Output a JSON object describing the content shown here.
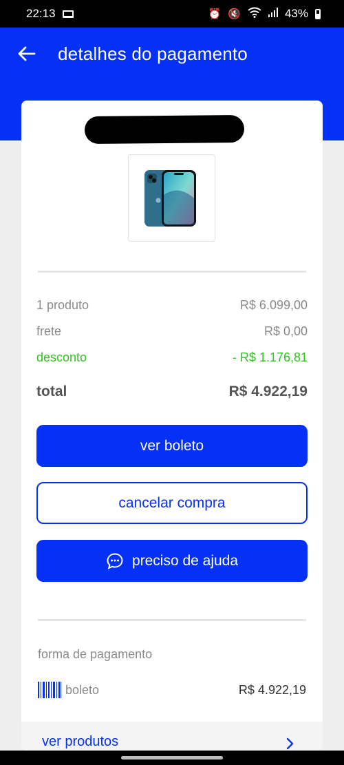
{
  "status_bar": {
    "time": "22:13",
    "battery": "43%",
    "icons": [
      "laptop-icon",
      "alarm-icon",
      "mute-icon",
      "wifi-icon",
      "signal-icon",
      "battery-icon"
    ]
  },
  "header": {
    "title": "detalhes do pagamento",
    "back_icon": "arrow-left-icon"
  },
  "order": {
    "product_image": "iphone-image",
    "lines": {
      "products_label": "1 produto",
      "products_value": "R$ 6.099,00",
      "shipping_label": "frete",
      "shipping_value": "R$ 0,00",
      "discount_label": "desconto",
      "discount_value": "- R$ 1.176,81",
      "total_label": "total",
      "total_value": "R$ 4.922,19"
    }
  },
  "actions": {
    "view_boleto": "ver boleto",
    "cancel_purchase": "cancelar compra",
    "need_help": "preciso de ajuda"
  },
  "payment": {
    "section_label": "forma de pagamento",
    "method": "boleto",
    "amount": "R$ 4.922,19"
  },
  "footer_link": {
    "label": "ver produtos"
  },
  "colors": {
    "primary": "#0530f5",
    "discount": "#2ec51f",
    "muted": "#8a8a8a"
  }
}
